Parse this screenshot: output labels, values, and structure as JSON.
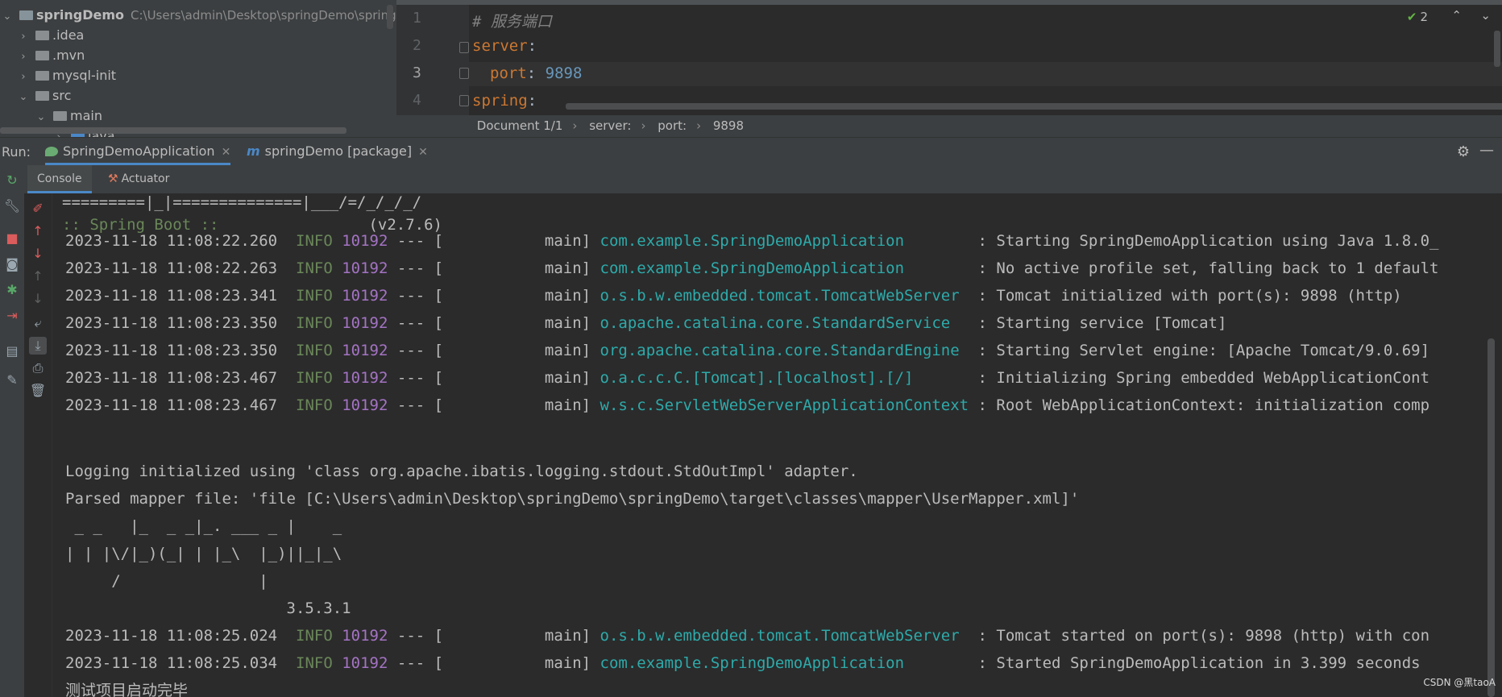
{
  "project_tree": {
    "root": {
      "name": "springDemo",
      "path": "C:\\Users\\admin\\Desktop\\springDemo\\springDe"
    },
    "items": [
      {
        "label": ".idea",
        "expanded": false
      },
      {
        "label": ".mvn",
        "expanded": false
      },
      {
        "label": "mysql-init",
        "expanded": false
      },
      {
        "label": "src",
        "expanded": true
      },
      {
        "label": "main",
        "expanded": true
      },
      {
        "label": "java",
        "expanded": false
      }
    ]
  },
  "editor": {
    "line_numbers": [
      "1",
      "2",
      "3",
      "4"
    ],
    "lines": [
      {
        "comment": "# 服务端口"
      },
      {
        "key": "server",
        "colon": ":"
      },
      {
        "key": "port",
        "colon": ":",
        "value": "9898"
      },
      {
        "key": "spring",
        "colon": ":"
      }
    ],
    "inspection_count": "2"
  },
  "breadcrumb": [
    "Document 1/1",
    "server:",
    "port:",
    "9898"
  ],
  "run": {
    "label": "Run:",
    "tabs": [
      {
        "label": "SpringDemoApplication",
        "active": true
      },
      {
        "label": "springDemo [package]",
        "active": false
      }
    ],
    "subtabs": [
      "Console",
      "Actuator"
    ]
  },
  "console": {
    "banner_line": "=========|_|==============|___/=/_/_/_/",
    "spring_boot_label": ":: Spring Boot ::",
    "spring_boot_version": "(v2.7.6)",
    "logs_1": [
      {
        "ts": "2023-11-18 11:08:22.260",
        "level": "INFO",
        "pid": "10192",
        "thread": "--- [           main]",
        "logger": "com.example.SpringDemoApplication       ",
        "msg": " : Starting SpringDemoApplication using Java 1.8.0_"
      },
      {
        "ts": "2023-11-18 11:08:22.263",
        "level": "INFO",
        "pid": "10192",
        "thread": "--- [           main]",
        "logger": "com.example.SpringDemoApplication       ",
        "msg": " : No active profile set, falling back to 1 default"
      },
      {
        "ts": "2023-11-18 11:08:23.341",
        "level": "INFO",
        "pid": "10192",
        "thread": "--- [           main]",
        "logger": "o.s.b.w.embedded.tomcat.TomcatWebServer ",
        "msg": " : Tomcat initialized with port(s): 9898 (http)"
      },
      {
        "ts": "2023-11-18 11:08:23.350",
        "level": "INFO",
        "pid": "10192",
        "thread": "--- [           main]",
        "logger": "o.apache.catalina.core.StandardService  ",
        "msg": " : Starting service [Tomcat]"
      },
      {
        "ts": "2023-11-18 11:08:23.350",
        "level": "INFO",
        "pid": "10192",
        "thread": "--- [           main]",
        "logger": "org.apache.catalina.core.StandardEngine ",
        "msg": " : Starting Servlet engine: [Apache Tomcat/9.0.69]"
      },
      {
        "ts": "2023-11-18 11:08:23.467",
        "level": "INFO",
        "pid": "10192",
        "thread": "--- [           main]",
        "logger": "o.a.c.c.C.[Tomcat].[localhost].[/]      ",
        "msg": " : Initializing Spring embedded WebApplicationCont"
      },
      {
        "ts": "2023-11-18 11:08:23.467",
        "level": "INFO",
        "pid": "10192",
        "thread": "--- [           main]",
        "logger": "w.s.c.ServletWebServerApplicationContext",
        "msg": " : Root WebApplicationContext: initialization comp"
      }
    ],
    "logging_line": "Logging initialized using 'class org.apache.ibatis.logging.stdout.StdOutImpl' adapter.",
    "mapper_line": "Parsed mapper file: 'file [C:\\Users\\admin\\Desktop\\springDemo\\springDemo\\target\\classes\\mapper\\UserMapper.xml]'",
    "mybatis_banner": [
      " _ _   |_  _ _|_. ___ _ |    _",
      "| | |\\/|_)(_| | |_\\  |_)||_|_\\",
      "     /               |",
      "                        3.5.3.1"
    ],
    "logs_2": [
      {
        "ts": "2023-11-18 11:08:25.024",
        "level": "INFO",
        "pid": "10192",
        "thread": "--- [           main]",
        "logger": "o.s.b.w.embedded.tomcat.TomcatWebServer ",
        "msg": " : Tomcat started on port(s): 9898 (http) with con"
      },
      {
        "ts": "2023-11-18 11:08:25.034",
        "level": "INFO",
        "pid": "10192",
        "thread": "--- [           main]",
        "logger": "com.example.SpringDemoApplication       ",
        "msg": " : Started SpringDemoApplication in 3.399 seconds"
      }
    ],
    "final_line": "测试项目启动完毕"
  },
  "watermark": "CSDN @黑taoA"
}
